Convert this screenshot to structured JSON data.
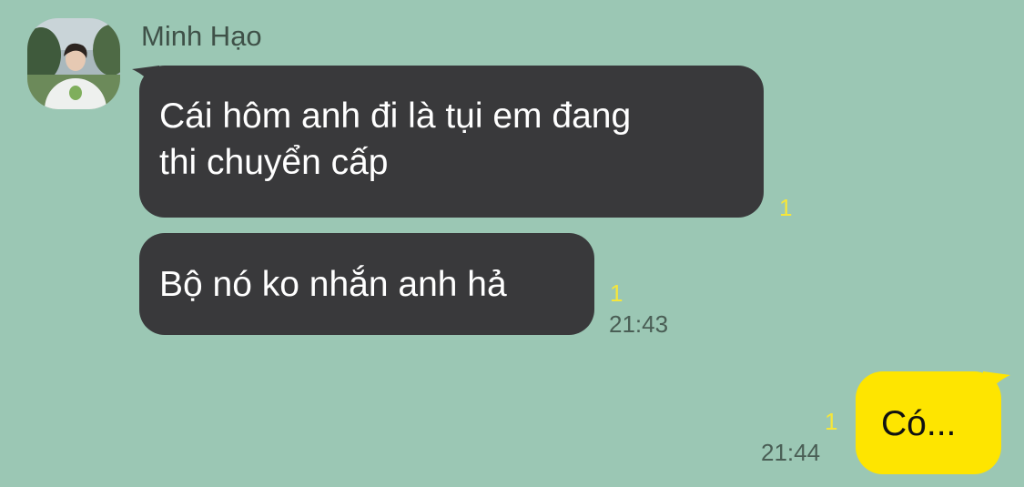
{
  "chat": {
    "sender": {
      "name": "Minh Hạo",
      "avatar": "profile-photo"
    },
    "messages": [
      {
        "direction": "incoming",
        "lines": [
          "Cái hôm anh đi là tụi em đang",
          "thi chuyển cấp"
        ],
        "unread_count": "1",
        "time": ""
      },
      {
        "direction": "incoming",
        "lines": [
          "Bộ nó ko nhắn anh hả"
        ],
        "unread_count": "1",
        "time": "21:43"
      },
      {
        "direction": "outgoing",
        "lines": [
          "Có..."
        ],
        "unread_count": "1",
        "time": "21:44"
      }
    ]
  },
  "colors": {
    "background": "#9bc7b4",
    "incoming_bubble": "#39393b",
    "outgoing_bubble": "#fee500",
    "unread_indicator": "#f5e63a"
  }
}
